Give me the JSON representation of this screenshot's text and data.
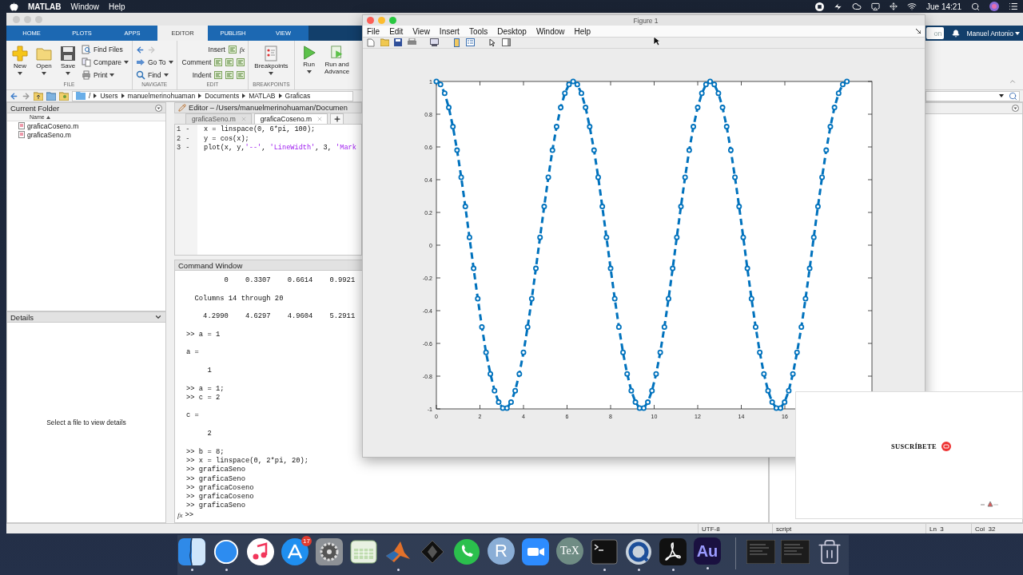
{
  "menubar": {
    "app": "MATLAB",
    "items": [
      "Window",
      "Help"
    ],
    "clock": "Jue 14:21"
  },
  "matlab": {
    "tabs": [
      {
        "label": "HOME",
        "selected": false
      },
      {
        "label": "PLOTS",
        "selected": false
      },
      {
        "label": "APPS",
        "selected": false
      },
      {
        "label": "EDITOR",
        "selected": true
      },
      {
        "label": "PUBLISH",
        "selected": false
      },
      {
        "label": "VIEW",
        "selected": false
      }
    ],
    "search": {
      "value": "on"
    },
    "user": "Manuel Antonio",
    "toolstrip": {
      "file": {
        "label": "FILE",
        "large": [
          {
            "label": "New",
            "kind": "new",
            "dropdown": true
          },
          {
            "label": "Open",
            "kind": "open",
            "dropdown": true
          },
          {
            "label": "Save",
            "kind": "save",
            "dropdown": true
          }
        ],
        "small": [
          {
            "label": "Find Files",
            "kind": "find-files",
            "dropdown": false
          },
          {
            "label": "Compare",
            "kind": "compare",
            "dropdown": true
          },
          {
            "label": "Print",
            "kind": "print",
            "dropdown": true
          }
        ]
      },
      "navigate": {
        "label": "NAVIGATE",
        "small": [
          {
            "label": "Go To",
            "kind": "goto",
            "dropdown": true
          },
          {
            "label": "Find",
            "kind": "find",
            "dropdown": true
          }
        ]
      },
      "edit": {
        "label": "EDIT",
        "rows": [
          {
            "label": "Insert",
            "function_glyph": "fx"
          },
          {
            "label": "Comment"
          },
          {
            "label": "Indent"
          }
        ]
      },
      "breakpoints": {
        "label": "BREAKPOINTS",
        "button": "Breakpoints"
      },
      "run": {
        "buttons": [
          {
            "label": "Run",
            "kind": "run",
            "dropdown": true
          },
          {
            "label": "Run and Advance",
            "kind": "advance",
            "dropdown": false
          }
        ]
      }
    },
    "address": {
      "segments": [
        "/",
        "Users",
        "manuelmerinohuaman",
        "Documents",
        "MATLAB",
        "Graficas"
      ]
    },
    "current_folder": {
      "title": "Current Folder",
      "column": "Name",
      "files": [
        "graficaCoseno.m",
        "graficaSeno.m"
      ]
    },
    "details": {
      "title": "Details",
      "message": "Select a file to view details"
    },
    "editor": {
      "title": "Editor – /Users/manuelmerinohuaman/Documen",
      "tabs": [
        {
          "label": "graficaSeno.m",
          "selected": false
        },
        {
          "label": "graficaCoseno.m",
          "selected": true
        }
      ],
      "lines": [
        {
          "number": "1",
          "marker": "-",
          "tokens": [
            {
              "kind": "code",
              "text": "x = linspace(0, 6*pi, 100);"
            }
          ]
        },
        {
          "number": "2",
          "marker": "-",
          "tokens": [
            {
              "kind": "code",
              "text": "y = cos(x);"
            }
          ]
        },
        {
          "number": "3",
          "marker": "-",
          "tokens": [
            {
              "kind": "code",
              "text": "plot(x, y,"
            },
            {
              "kind": "string",
              "text": "'--'"
            },
            {
              "kind": "code",
              "text": ", "
            },
            {
              "kind": "string",
              "text": "'LineWidth'"
            },
            {
              "kind": "code",
              "text": ", 3, "
            },
            {
              "kind": "string",
              "text": "'Mark"
            }
          ]
        }
      ]
    },
    "command_window": {
      "title": "Command Window",
      "blocks": [
        [
          "         0    0.3307    0.6614    0.9921"
        ],
        [
          "  Columns 14 through 20"
        ],
        [
          "    4.2990    4.6297    4.9604    5.2911"
        ],
        [
          ">> a = 1"
        ],
        [
          "a ="
        ],
        [
          "     1"
        ],
        [
          ">> a = 1;",
          ">> c = 2"
        ],
        [
          "c ="
        ],
        [
          "     2"
        ],
        [
          ">> b = 8;",
          ">> x = linspace(0, 2*pi, 20);",
          ">> graficaSeno",
          ">> graficaSeno",
          ">> graficaCoseno",
          ">> graficaCoseno",
          ">> graficaSeno"
        ]
      ],
      "function_button": "fx",
      "prompt": ">>"
    },
    "status_bar": {
      "encoding": "UTF-8",
      "file_type": "script",
      "line": "Ln  3",
      "column": "Col  32"
    }
  },
  "figure": {
    "title": "Figure 1",
    "menu": [
      "File",
      "Edit",
      "View",
      "Insert",
      "Tools",
      "Desktop",
      "Window",
      "Help"
    ],
    "chart_data": {
      "type": "line",
      "xlim": [
        0,
        20
      ],
      "ylim": [
        -1,
        1
      ],
      "xticks": [
        0,
        2,
        4,
        6,
        8,
        10,
        12,
        14,
        16
      ],
      "yticks": [
        -1,
        -0.8,
        -0.6,
        -0.4,
        -0.2,
        0,
        0.2,
        0.4,
        0.6,
        0.8,
        1
      ],
      "x": [
        0,
        0.19,
        0.38,
        0.57,
        0.76,
        0.95,
        1.14,
        1.33,
        1.52,
        1.71,
        1.9,
        2.09,
        2.28,
        2.48,
        2.67,
        2.86,
        3.05,
        3.24,
        3.43,
        3.62,
        3.81,
        4,
        4.19,
        4.38,
        4.57,
        4.76,
        4.95,
        5.14,
        5.33,
        5.52,
        5.71,
        5.9,
        6.09,
        6.28,
        6.47,
        6.66,
        6.85,
        7.04,
        7.24,
        7.43,
        7.62,
        7.81,
        8,
        8.19,
        8.38,
        8.57,
        8.76,
        8.95,
        9.14,
        9.33,
        9.52,
        9.71,
        9.9,
        10.09,
        10.28,
        10.47,
        10.66,
        10.85,
        11.04,
        11.23,
        11.42,
        11.61,
        11.8,
        12,
        12.19,
        12.38,
        12.57,
        12.76,
        12.95,
        13.14,
        13.33,
        13.52,
        13.71,
        13.9,
        14.09,
        14.28,
        14.47,
        14.66,
        14.85,
        15.04,
        15.23,
        15.42,
        15.61,
        15.8,
        15.99,
        16.18,
        16.37,
        16.56,
        16.76,
        16.95,
        17.14,
        17.33,
        17.52,
        17.71,
        17.9,
        18.09,
        18.28,
        18.47,
        18.66,
        18.85
      ],
      "series": [
        {
          "color": "#0072bd",
          "line_style": "dashed",
          "marker": "o",
          "values": [
            1,
            0.982,
            0.928,
            0.841,
            0.724,
            0.58,
            0.415,
            0.236,
            0.048,
            -0.142,
            -0.327,
            -0.5,
            -0.655,
            -0.786,
            -0.889,
            -0.959,
            -0.995,
            -0.995,
            -0.959,
            -0.889,
            -0.786,
            -0.655,
            -0.5,
            -0.327,
            -0.142,
            0.048,
            0.236,
            0.415,
            0.58,
            0.724,
            0.841,
            0.928,
            0.982,
            1,
            0.982,
            0.928,
            0.841,
            0.724,
            0.58,
            0.415,
            0.236,
            0.048,
            -0.142,
            -0.327,
            -0.5,
            -0.655,
            -0.786,
            -0.889,
            -0.959,
            -0.995,
            -0.995,
            -0.959,
            -0.889,
            -0.786,
            -0.655,
            -0.5,
            -0.327,
            -0.142,
            0.048,
            0.236,
            0.415,
            0.58,
            0.724,
            0.841,
            0.928,
            0.982,
            1,
            0.982,
            0.928,
            0.841,
            0.724,
            0.58,
            0.415,
            0.236,
            0.048,
            -0.142,
            -0.327,
            -0.5,
            -0.655,
            -0.786,
            -0.889,
            -0.959,
            -0.995,
            -0.995,
            -0.959,
            -0.889,
            -0.786,
            -0.655,
            -0.5,
            -0.327,
            -0.142,
            0.048,
            0.236,
            0.415,
            0.58,
            0.724,
            0.841,
            0.928,
            0.982,
            1
          ]
        }
      ]
    }
  },
  "overlay": {
    "text": "SUSCRÍBETE"
  },
  "dock": {
    "apps": [
      {
        "kind": "finder",
        "running": true
      },
      {
        "kind": "safari",
        "running": true
      },
      {
        "kind": "music",
        "running": false
      },
      {
        "kind": "store",
        "running": false,
        "badge": "17"
      },
      {
        "kind": "settings",
        "running": false
      },
      {
        "kind": "keyboard",
        "running": false
      },
      {
        "kind": "matlab",
        "running": true
      },
      {
        "kind": "diamond",
        "running": false
      },
      {
        "kind": "chat",
        "running": false
      },
      {
        "kind": "label",
        "label": "R",
        "running": false
      },
      {
        "kind": "camera",
        "running": false
      },
      {
        "kind": "label",
        "label": "TeX",
        "running": false
      },
      {
        "kind": "terminal",
        "running": true
      },
      {
        "kind": "ring",
        "running": true
      },
      {
        "kind": "swirl",
        "running": true
      },
      {
        "kind": "label",
        "label": "Au",
        "running": true
      }
    ],
    "others": [
      {
        "kind": "thumbnail"
      },
      {
        "kind": "thumbnail"
      },
      {
        "kind": "trash"
      }
    ]
  }
}
